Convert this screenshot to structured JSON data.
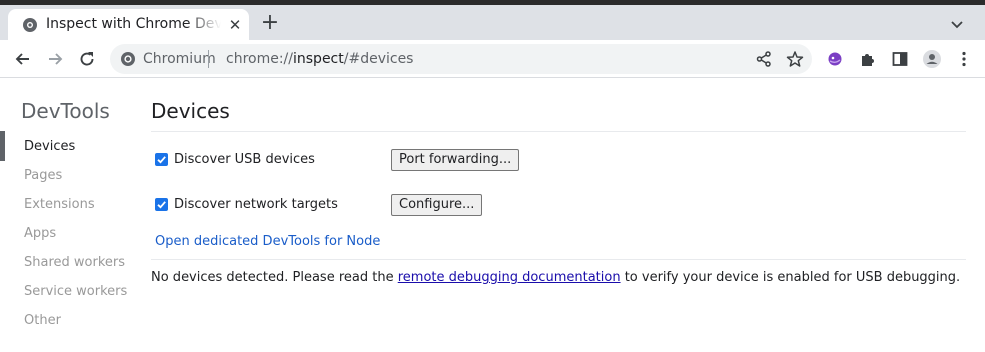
{
  "browser": {
    "tab": {
      "title": "Inspect with Chrome Developer Tools",
      "close_glyph": "✕"
    },
    "new_tab_glyph": "+",
    "omnibox": {
      "origin_label": "Chromium",
      "url_scheme": "chrome://",
      "url_host": "inspect",
      "url_path": "/#devices"
    },
    "extension_accent": "#7b3fc4"
  },
  "sidebar": {
    "title": "DevTools",
    "items": [
      {
        "label": "Devices",
        "active": true
      },
      {
        "label": "Pages",
        "active": false
      },
      {
        "label": "Extensions",
        "active": false
      },
      {
        "label": "Apps",
        "active": false
      },
      {
        "label": "Shared workers",
        "active": false
      },
      {
        "label": "Service workers",
        "active": false
      },
      {
        "label": "Other",
        "active": false
      }
    ]
  },
  "main": {
    "title": "Devices",
    "usb": {
      "label": "Discover USB devices",
      "checked": true,
      "button": "Port forwarding..."
    },
    "network": {
      "label": "Discover network targets",
      "checked": true,
      "button": "Configure..."
    },
    "node_link": "Open dedicated DevTools for Node",
    "message": {
      "before": "No devices detected. Please read the ",
      "link": "remote debugging documentation",
      "after": " to verify your device is enabled for USB debugging."
    }
  },
  "colors": {
    "accent": "#1a73e8",
    "link": "#1a5dc9",
    "tabstrip": "#dee1e6",
    "omnibox": "#f1f3f4"
  }
}
